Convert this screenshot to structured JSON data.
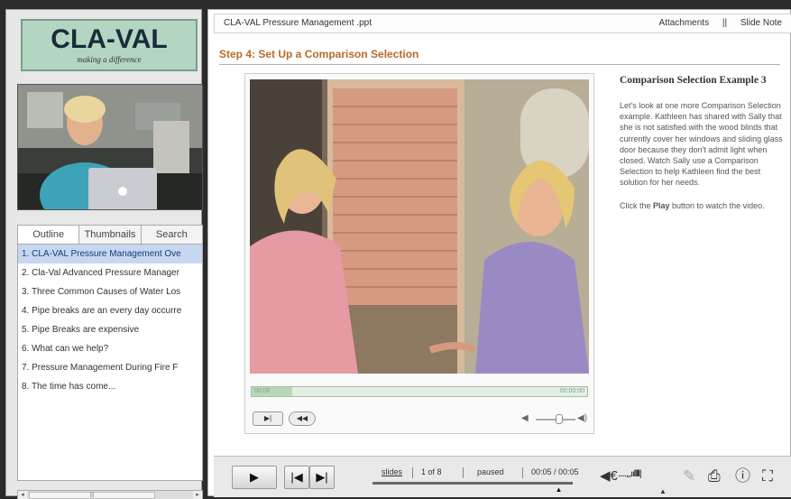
{
  "logo": {
    "name": "CLA-VAL",
    "tagline": "making a difference"
  },
  "tabs": [
    {
      "label": "Outline"
    },
    {
      "label": "Thumbnails"
    },
    {
      "label": "Search"
    }
  ],
  "outline": [
    {
      "label": "1. CLA-VAL Pressure Management Ove"
    },
    {
      "label": "2. Cla-Val Advanced Pressure Manager"
    },
    {
      "label": "3. Three Common Causes of Water Los"
    },
    {
      "label": "4. Pipe breaks are an every day occurre"
    },
    {
      "label": "5. Pipe Breaks are expensive"
    },
    {
      "label": "6. What can we help?"
    },
    {
      "label": "7. Pressure Management  During Fire F"
    },
    {
      "label": "8. The time has come..."
    }
  ],
  "topbar": {
    "title": "CLA-VAL Pressure Management .ppt",
    "attachments": "Attachments",
    "separator": "||",
    "slide_note": "Slide Note"
  },
  "step_title": "Step 4: Set Up a Comparison Selection",
  "side": {
    "title": "Comparison Selection Example 3",
    "body": "Let's look at one more Comparison Selection example. Kathleen has shared with Sally that she is not satisfied with the wood blinds that currently cover her windows and sliding glass door because they don't admit light when closed. Watch Sally use a Comparison Selection to help Kathleen find the best solution for her needs.",
    "play_prefix": "Click the ",
    "play_word": "Play",
    "play_suffix": " button to watch the video."
  },
  "player": {
    "time_start": "00:00",
    "time_end": "00:00:00",
    "progress": 0.12,
    "volume": 0.55
  },
  "bottom": {
    "slides_label": "slides",
    "slide_position": "1 of 8",
    "status": "paused",
    "time": "00:05 / 00:05",
    "progress": 0.93
  },
  "colors": {
    "accent": "#b86a2a",
    "outline_active": "#c6d7ef",
    "logo_bg": "#b3d6c3"
  }
}
